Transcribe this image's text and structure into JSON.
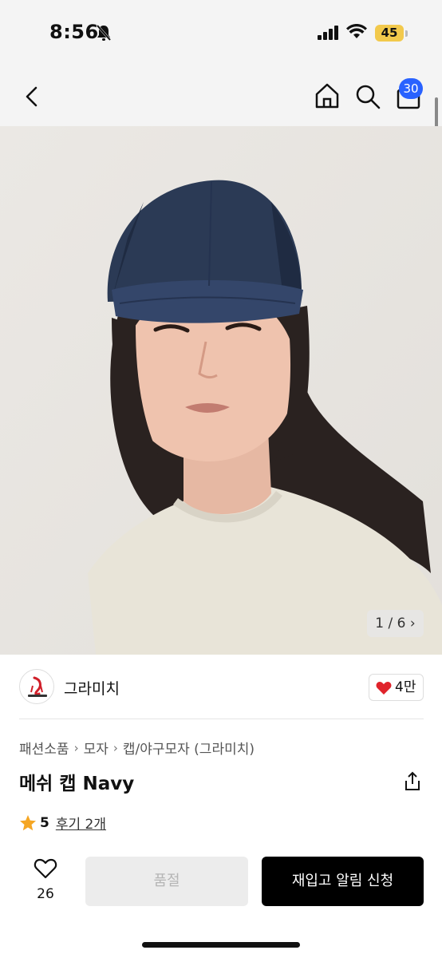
{
  "status": {
    "time": "8:56",
    "battery": "45"
  },
  "nav": {
    "cart_count": "30"
  },
  "hero": {
    "counter": "1 / 6",
    "colors": {
      "background": "#e9e6e2",
      "cap": "#2b3a55",
      "shirt": "#e8e4d8",
      "hair": "#2a2220"
    }
  },
  "brand": {
    "name": "그라미치",
    "likes": "4만"
  },
  "breadcrumb": [
    "패션소품",
    "모자",
    "캡/야구모자 (그라미치)"
  ],
  "product": {
    "title": "메쉬 캡 Navy",
    "rating": "5",
    "reviews": "후기 2개"
  },
  "bottom": {
    "wish_count": "26",
    "soldout_label": "품절",
    "restock_label": "재입고 알림 신청"
  },
  "colors": {
    "accent": "#2962ff",
    "heart": "#e0232b",
    "star": "#f5a623"
  }
}
